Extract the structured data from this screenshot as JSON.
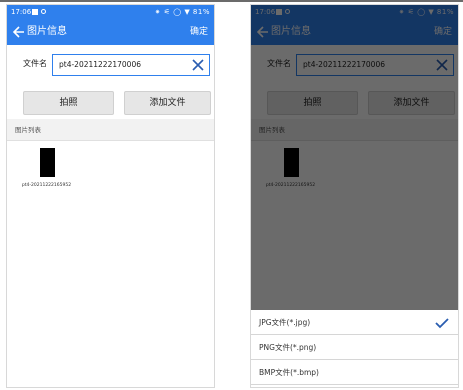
{
  "status": {
    "time": "17:06",
    "right": "⁕ ⚟ ◯ ▼ 81%"
  },
  "nav": {
    "title": "图片信息",
    "confirm": "确定"
  },
  "file_name": {
    "label": "文件名",
    "value": "pt4-20211222170006"
  },
  "buttons": {
    "take_photo": "拍照",
    "add_file": "添加文件"
  },
  "list_label": "图片列表",
  "thumbnail": {
    "caption": "pt4-20211222165952"
  },
  "file_types": [
    {
      "label": "JPG文件(*.jpg)",
      "selected": true
    },
    {
      "label": "PNG文件(*.png)",
      "selected": false
    },
    {
      "label": "BMP文件(*.bmp)",
      "selected": false
    }
  ],
  "colors": {
    "accent": "#2f80ed",
    "overlay": "#000000"
  }
}
